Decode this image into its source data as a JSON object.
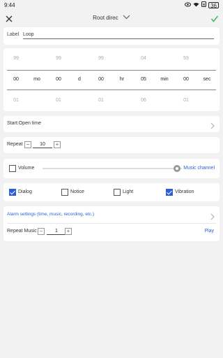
{
  "status_bar": {
    "time": "9:44",
    "battery": "36"
  },
  "header": {
    "title": "Root direc"
  },
  "label_row": {
    "label": "Label",
    "value": "Loop"
  },
  "picker": {
    "above": [
      "99",
      "99",
      "99",
      "04",
      "59"
    ],
    "selected": [
      "00",
      "00",
      "00",
      "05",
      "00"
    ],
    "below": [
      "01",
      "01",
      "01",
      "06",
      "01"
    ],
    "units": [
      "mo",
      "d",
      "hr",
      "min",
      "sec"
    ]
  },
  "start": {
    "text": "Start:Open time"
  },
  "repeat": {
    "label": "Repeat",
    "value": "10",
    "minus": "−",
    "plus": "+"
  },
  "volume": {
    "label": "Volume",
    "checked": false,
    "level": 1.0,
    "channel_label": "Music channel"
  },
  "options": [
    {
      "label": "Dialog",
      "checked": true
    },
    {
      "label": "Notice",
      "checked": false
    },
    {
      "label": "Light",
      "checked": false
    },
    {
      "label": "Vibration",
      "checked": true
    }
  ],
  "alarm": {
    "settings_label": "Alarm settings (time, music, recording, etc.)",
    "repeat_music_label": "Repeat Music",
    "repeat_music_value": "1",
    "play_label": "Play"
  },
  "colors": {
    "accent": "#2b5fd9",
    "confirm": "#3cba54",
    "background": "#f2f2f2"
  }
}
